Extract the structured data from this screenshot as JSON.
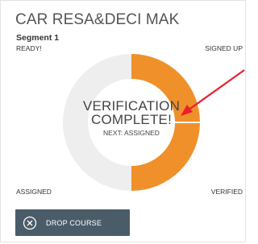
{
  "card": {
    "title": "CAR RESA&DECI MAK",
    "segment": "Segment 1"
  },
  "stages": {
    "ready": "READY!",
    "signed_up": "SIGNED UP",
    "assigned": "ASSIGNED",
    "verified": "VERIFIED"
  },
  "status": {
    "line1": "VERIFICATION",
    "line2": "COMPLETE!",
    "next": "NEXT: ASSIGNED"
  },
  "progress": {
    "completed_fraction": 0.5,
    "complete_color": "#f0902a",
    "pending_color": "#eeeeee"
  },
  "annotation": {
    "arrow_color": "#e8202a"
  },
  "actions": {
    "drop_course_label": "DROP COURSE",
    "drop_icon": "close-circle-icon"
  }
}
